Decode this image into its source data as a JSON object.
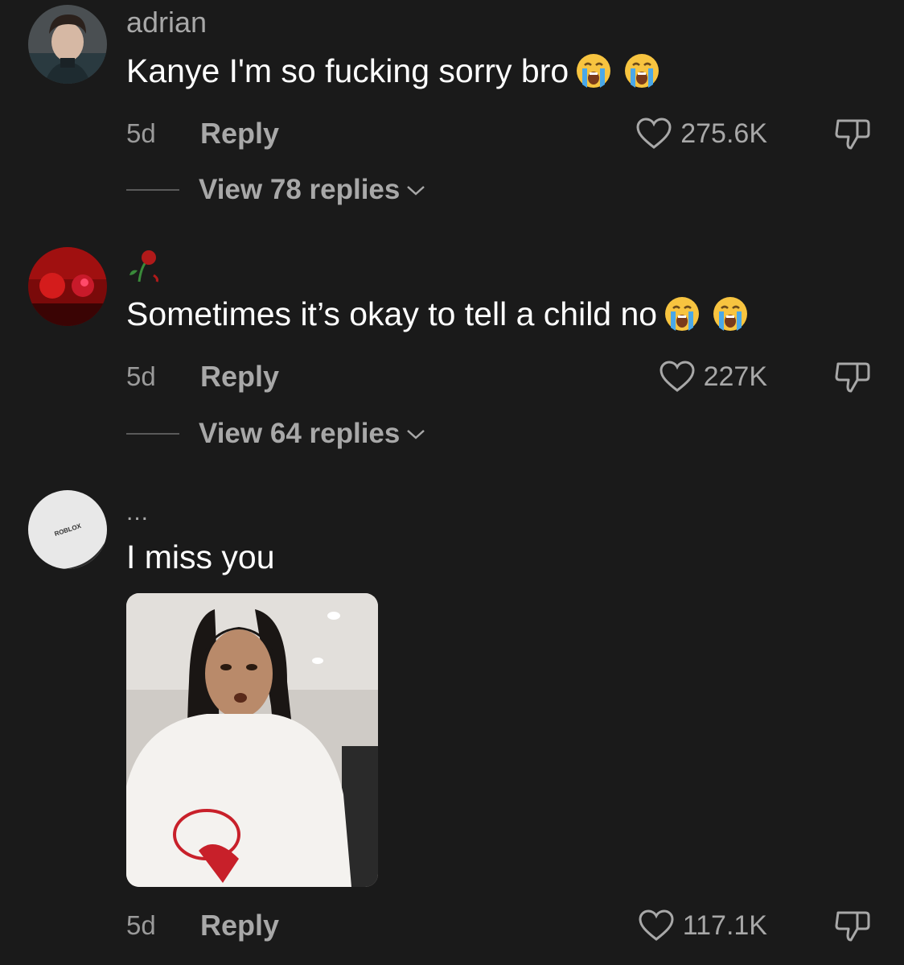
{
  "comments": [
    {
      "username": "adrian",
      "text": "Kanye I'm so fucking sorry bro",
      "emojis": [
        "loudly-crying-face",
        "loudly-crying-face"
      ],
      "time": "5d",
      "reply_label": "Reply",
      "likes": "275.6K",
      "view_replies": "View 78 replies"
    },
    {
      "username_icon": "wilted-rose",
      "text": "Sometimes it’s okay to tell a child no",
      "emojis": [
        "loudly-crying-face",
        "loudly-crying-face"
      ],
      "time": "5d",
      "reply_label": "Reply",
      "likes": "227K",
      "view_replies": "View 64 replies"
    },
    {
      "username": "...",
      "avatar_logo": "ROBLOX",
      "text": "I miss you",
      "attachment": "photo",
      "time": "5d",
      "reply_label": "Reply",
      "likes": "117.1K"
    }
  ],
  "colors": {
    "background": "#1a1a1a",
    "primary_text": "#ffffff",
    "secondary_text": "#a8a8a8"
  }
}
